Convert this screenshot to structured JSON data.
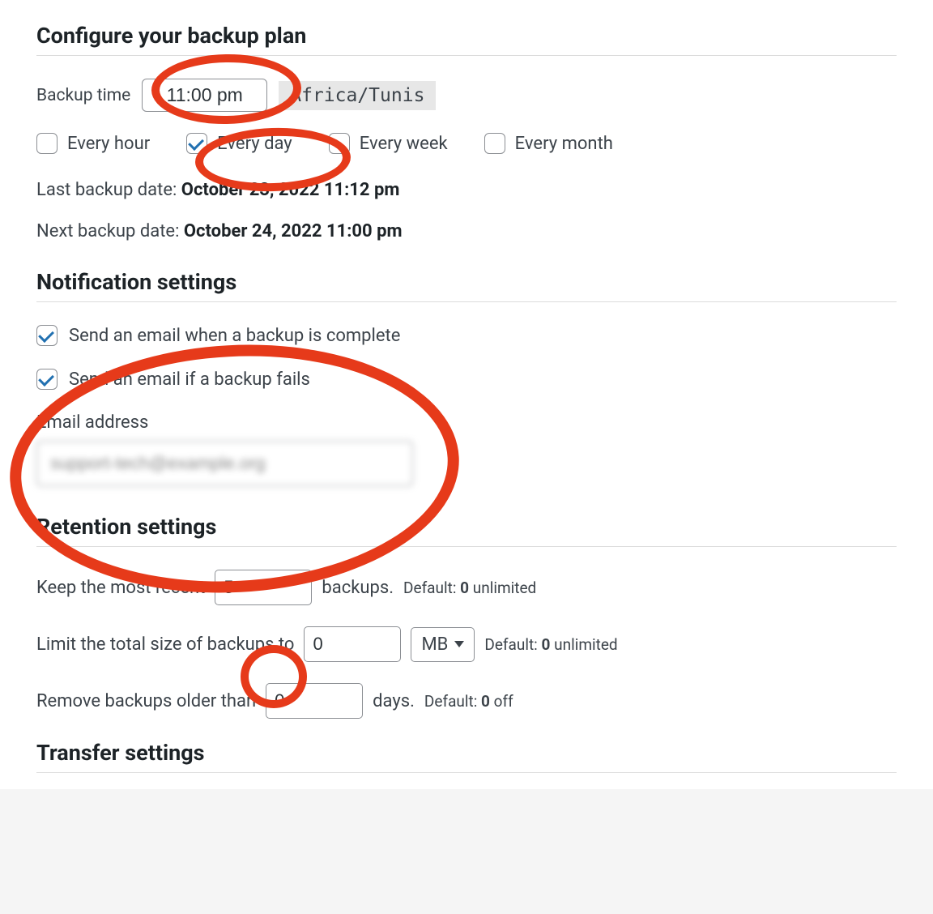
{
  "sections": {
    "configure": {
      "title": "Configure your backup plan",
      "backup_time_label": "Backup time",
      "backup_time_value": "11:00 pm",
      "timezone": "Africa/Tunis",
      "frequencies": [
        {
          "label": "Every hour",
          "checked": false
        },
        {
          "label": "Every day",
          "checked": true
        },
        {
          "label": "Every week",
          "checked": false
        },
        {
          "label": "Every month",
          "checked": false
        }
      ],
      "last_backup_label": "Last backup date: ",
      "last_backup_value": "October 23, 2022 11:12 pm",
      "next_backup_label": "Next backup date: ",
      "next_backup_value": "October 24, 2022 11:00 pm"
    },
    "notification": {
      "title": "Notification settings",
      "items": [
        {
          "label": "Send an email when a backup is complete",
          "checked": true
        },
        {
          "label": "Send an email if a backup fails",
          "checked": true
        }
      ],
      "email_label": "Email address",
      "email_value": "support-tech@example.org"
    },
    "retention": {
      "title": "Retention settings",
      "keep_recent_prefix": "Keep the most recent",
      "keep_recent_value": "5",
      "keep_recent_suffix": "backups.",
      "keep_recent_default": "Default: ",
      "keep_recent_default_zero": "0",
      "keep_recent_default_text": " unlimited",
      "limit_size_prefix": "Limit the total size of backups to",
      "limit_size_value": "0",
      "limit_size_unit": "MB",
      "limit_size_default": "Default: ",
      "limit_size_default_zero": "0",
      "limit_size_default_text": " unlimited",
      "remove_older_prefix": "Remove backups older than",
      "remove_older_value": "0",
      "remove_older_suffix": "days.",
      "remove_older_default": "Default: ",
      "remove_older_default_zero": "0",
      "remove_older_default_text": " off"
    },
    "transfer": {
      "title": "Transfer settings"
    }
  }
}
